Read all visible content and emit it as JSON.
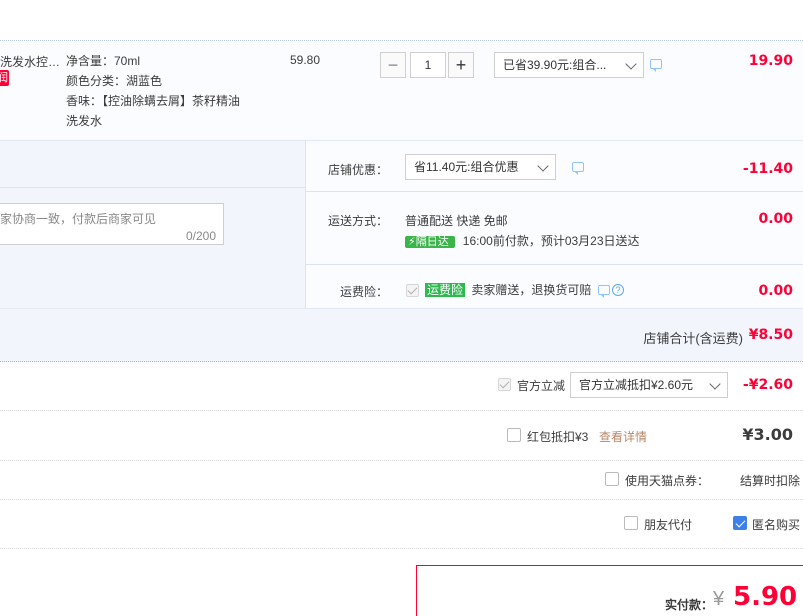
{
  "product": {
    "title": "洗发水控…",
    "tag": "润",
    "attrs": [
      "净含量：70ml",
      "颜色分类：湖蓝色",
      "香味：【控油除螨去屑】茶籽精油",
      "洗发水"
    ],
    "unit_price": "59.80",
    "qty_minus": "−",
    "qty_value": "1",
    "qty_plus": "+",
    "promo_select": "已省39.90元:组合...",
    "subtotal": "19.90"
  },
  "shop": {
    "discount_label": "店铺优惠：",
    "discount_select": "省11.40元:组合优惠",
    "discount_amount": "-11.40",
    "message_placeholder": "家协商一致，付款后商家可见",
    "message_count": "0/200",
    "shipping_label": "运送方式：",
    "shipping_method": "普通配送 快递 免邮",
    "shipping_badge": "隔日达",
    "shipping_eta": "16:00前付款，预计03月23日送达",
    "shipping_amount": "0.00",
    "insurance_label": "运费险：",
    "insurance_badge": "运费险",
    "insurance_text": "卖家赠送，退换货可赔",
    "insurance_amount": "0.00",
    "total_label": "店铺合计(含运费)",
    "total_amount": "¥8.50"
  },
  "order": {
    "official_label": "官方立减",
    "official_select": "官方立减抵扣¥2.60元",
    "official_amount": "-¥2.60",
    "redpacket_label": "红包抵扣¥3",
    "redpacket_link": "查看详情",
    "redpacket_amount": "¥3.00",
    "tmall_points_label": "使用天猫点券：",
    "tmall_points_note": "结算时扣除",
    "friend_pay_label": "朋友代付",
    "anonymous_label": "匿名购买",
    "pay_label": "实付款：",
    "pay_currency": "¥",
    "pay_amount": "5.90"
  },
  "colors": {
    "accent_red": "#ff0036",
    "link_orange": "#b7876a",
    "checkbox_blue": "#3f7fea",
    "badge_green": "#3bb54a"
  }
}
